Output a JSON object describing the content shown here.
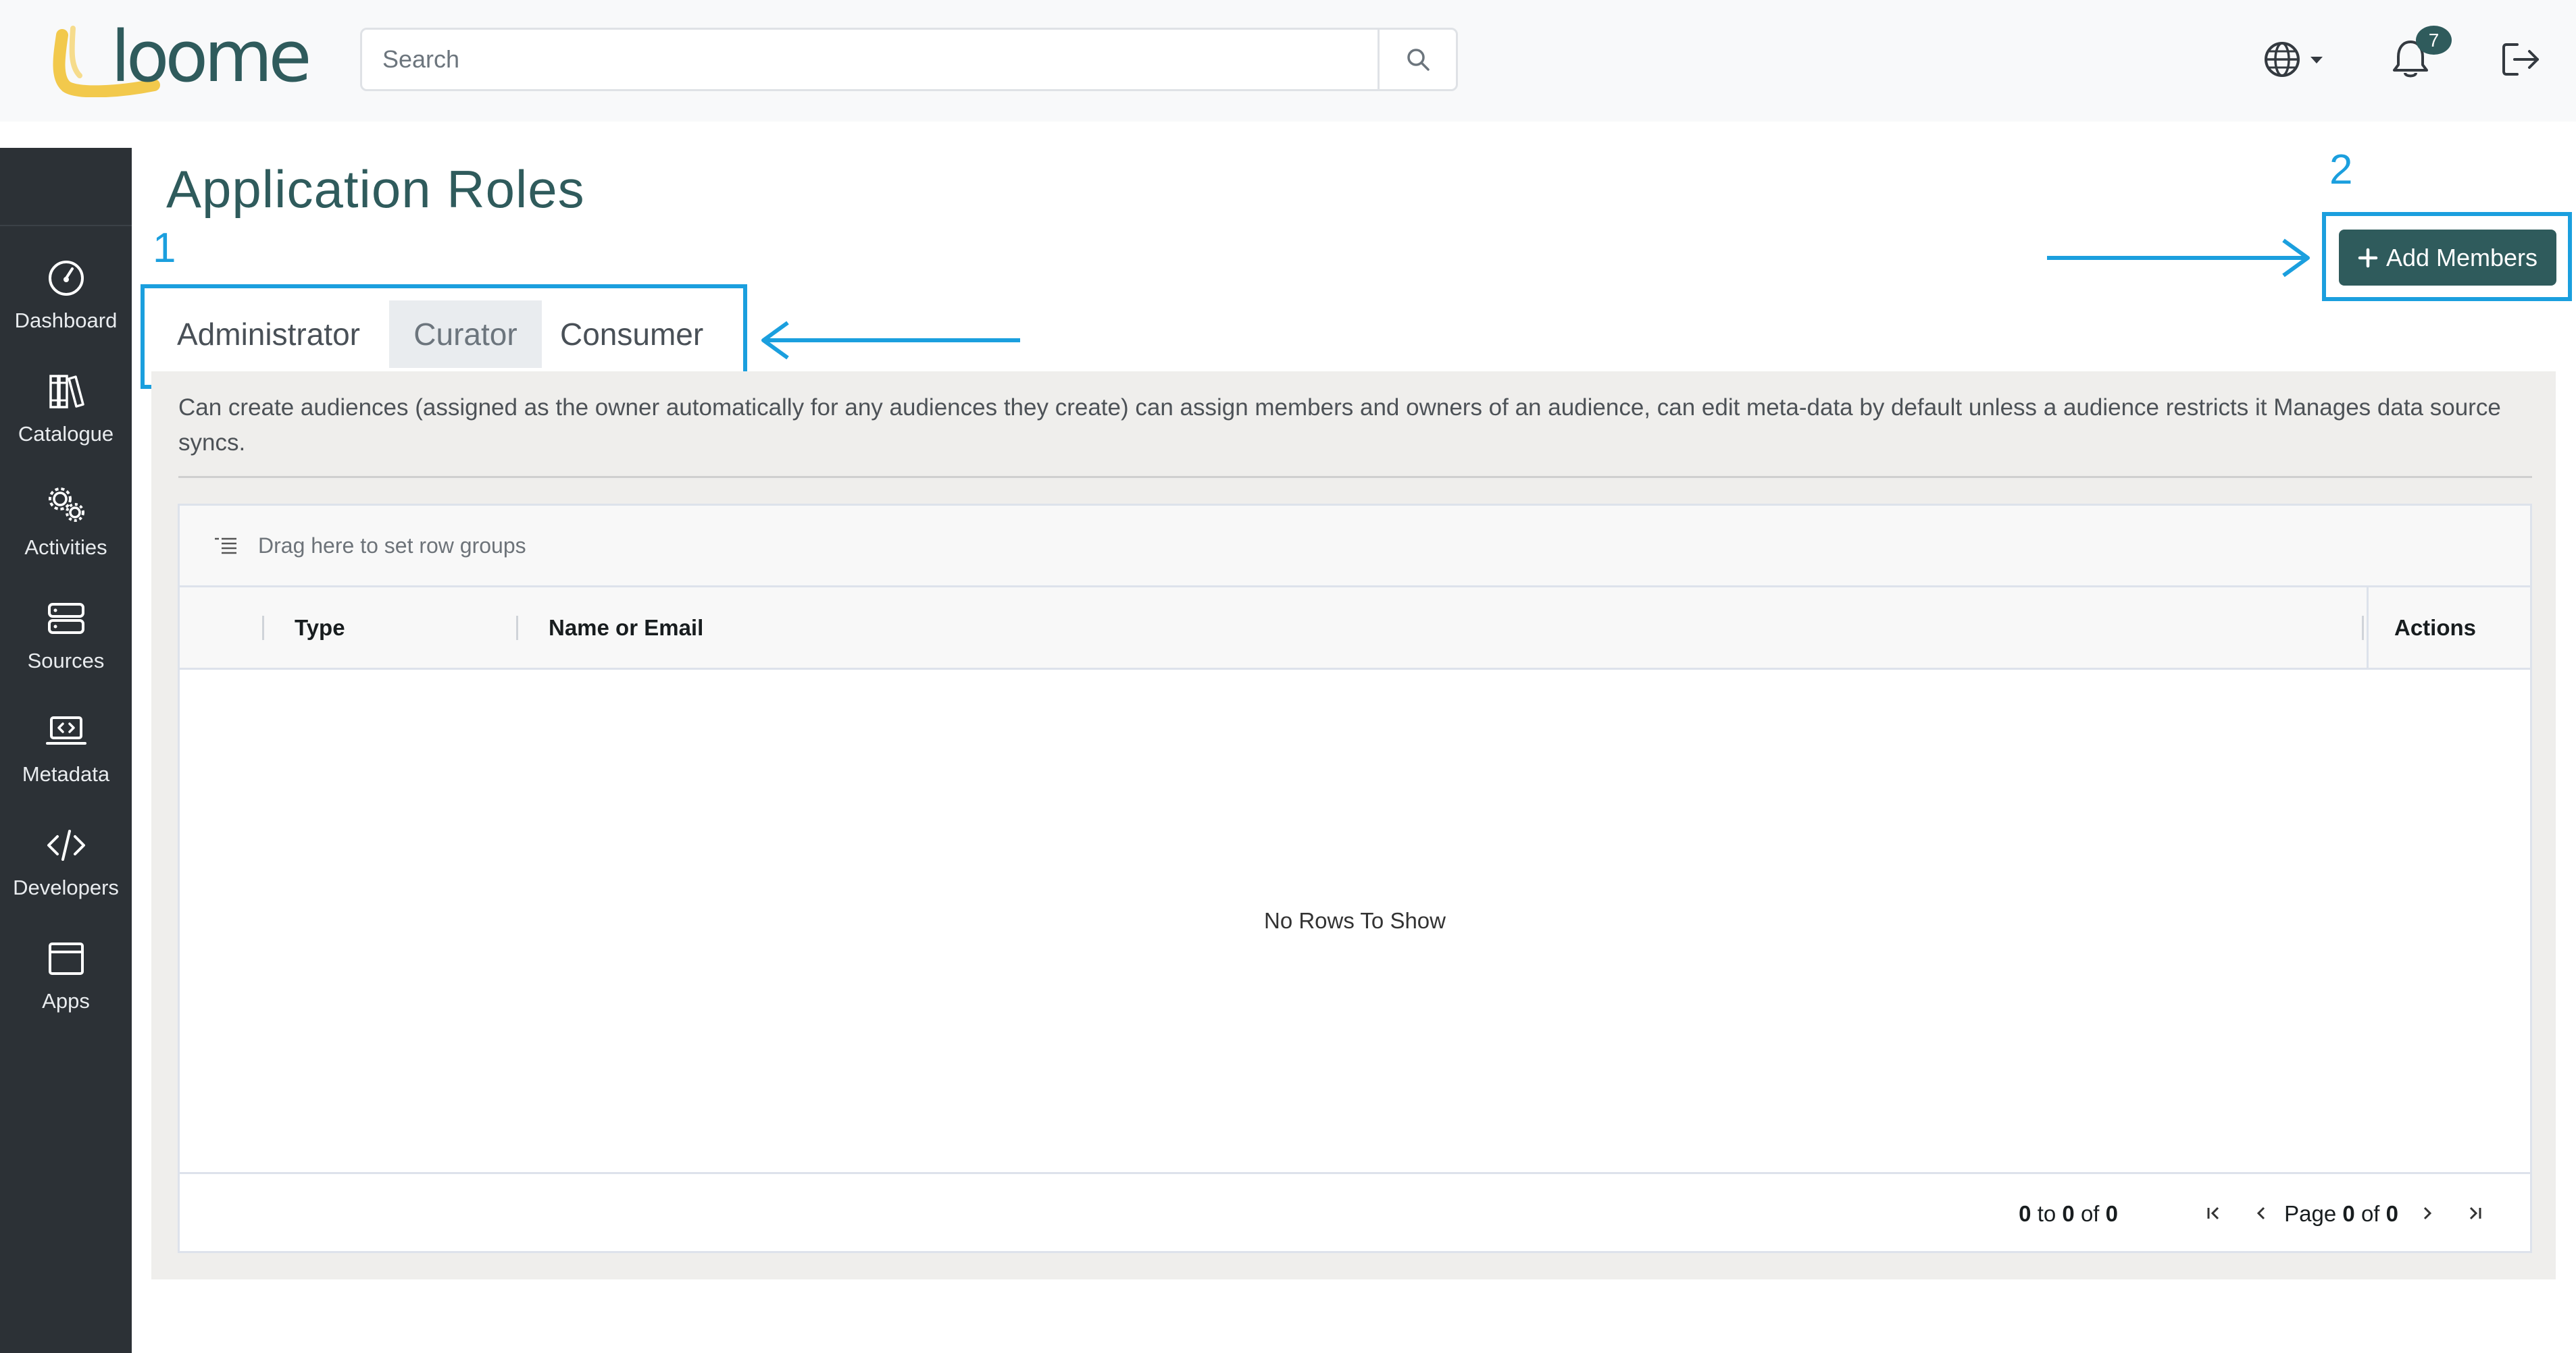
{
  "app": {
    "logo_text": "loome"
  },
  "search": {
    "placeholder": "Search"
  },
  "notifications": {
    "count": "7"
  },
  "sidebar": {
    "items": [
      {
        "label": "Dashboard",
        "icon": "gauge-icon"
      },
      {
        "label": "Catalogue",
        "icon": "books-icon"
      },
      {
        "label": "Activities",
        "icon": "gears-icon"
      },
      {
        "label": "Sources",
        "icon": "server-icon"
      },
      {
        "label": "Metadata",
        "icon": "laptop-code-icon"
      },
      {
        "label": "Developers",
        "icon": "code-icon"
      },
      {
        "label": "Apps",
        "icon": "window-icon"
      }
    ]
  },
  "page": {
    "title": "Application Roles"
  },
  "tabs": [
    {
      "label": "Administrator",
      "state": "default"
    },
    {
      "label": "Curator",
      "state": "highlighted"
    },
    {
      "label": "Consumer",
      "state": "default"
    }
  ],
  "toolbar": {
    "add_members_label": "Add Members",
    "add_icon": "plus-icon"
  },
  "role_description": "Can create audiences (assigned as the owner automatically for any audiences they create) can assign members and owners of an audience, can edit meta-data by default unless a audience restricts it Manages data source syncs.",
  "grid": {
    "group_placeholder": "Drag here to set row groups",
    "columns": [
      "Type",
      "Name or Email",
      "Actions"
    ],
    "empty_message": "No Rows To Show",
    "summary": {
      "from": "0",
      "to_word": "to",
      "to": "0",
      "of_word": "of",
      "total": "0"
    },
    "pager": {
      "page_word": "Page",
      "page": "0",
      "of_word": "of",
      "pages": "0"
    }
  },
  "annotations": [
    {
      "number": "1",
      "target": "role tabs"
    },
    {
      "number": "2",
      "target": "Add Members button"
    }
  ],
  "colors": {
    "brand_teal": "#2f5b5c",
    "logo_yellow": "#f2c94c",
    "annotation_blue": "#1b9fde",
    "sidebar_bg": "#2c3136",
    "panel_bg": "#efeeec"
  }
}
